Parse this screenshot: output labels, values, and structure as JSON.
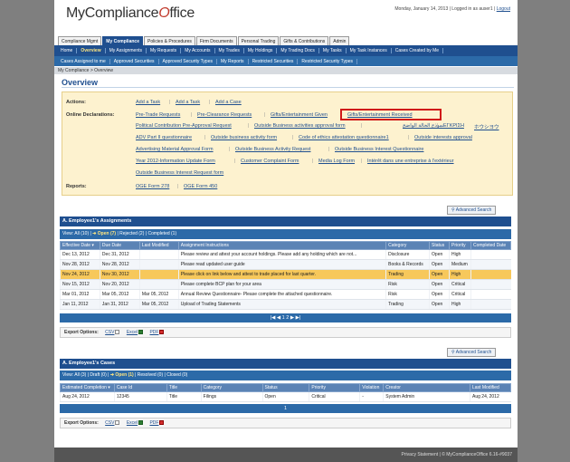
{
  "app": {
    "logo_left": "MyCompliance",
    "logo_mark": "O",
    "logo_right": "ffice",
    "date": "Monday, January 14, 2013 | Logged in as auser1 |",
    "logout": "Logout"
  },
  "tabs": [
    "Compliance Mgmt",
    "My Compliance",
    "Policies & Procedures",
    "Firm Documents",
    "Personal Trading",
    "Gifts & Contributions",
    "Admin"
  ],
  "nav1": [
    "Home",
    "Overview",
    "My Assignments",
    "My Requests",
    "My Accounts",
    "My Trades",
    "My Holdings",
    "My Trading Docs",
    "My Tasks",
    "My Task Instances",
    "Cases Created by Me"
  ],
  "nav2": [
    "Cases Assigned to me",
    "Approved Securities",
    "Approved Security Types",
    "My Reports",
    "Restricted Securities",
    "Restricted Security Types"
  ],
  "breadcrumb": "My Compliance > Overview",
  "page_title": "Overview",
  "actions": {
    "actions_label": "Actions:",
    "declarations_label": "Online Declarations:",
    "reports_label": "Reports:",
    "action_links": [
      "Add a Task",
      "Add a Task",
      "Add a Case"
    ],
    "decl_row1": [
      "Pre-Trade Requests",
      "Pre-Clearance Requests",
      "Gifts/Entertainment Given",
      "Gifts/Entertainment Received",
      "نموذج الحالة الواضح",
      "ΕΓΚΡΙΣΗ"
    ],
    "decl_row2": [
      "Political Contribution Pre-Approval Request",
      "Outside Business activities approval form",
      "ホウシヨウ"
    ],
    "decl_row3": [
      "ADV Part II questionnaire",
      "Outside business activity form",
      "Code of ethics attestation questionnaire1",
      "Outside interests approval"
    ],
    "decl_row4": [
      "Advertising Material Approval Form",
      "Outside Business Activity Request",
      "Outside Business Interest Questionnaire"
    ],
    "decl_row5": [
      "Year 2012-Information Update Form",
      "Customer Complaint Form",
      "Media Log Form",
      "Intérêt dans une entreprise à l'extérieur"
    ],
    "decl_row6": [
      "Outside Business Interest Request form"
    ],
    "report_links": [
      "OGE Form 278",
      "OGE Form 450"
    ]
  },
  "advanced_search_label": "Advanced Search",
  "assignments": {
    "title": "A. Employee1's Assignments",
    "view_label": "View:",
    "filters": [
      "All (10)",
      "Open (7)",
      "Rejected (2)",
      "Completed (1)"
    ],
    "columns": [
      "Effective Date",
      "Due Date",
      "Last Modified",
      "Assignment Instructions",
      "Category",
      "Status",
      "Priority",
      "Completed Date"
    ],
    "rows": [
      [
        "Dec 13, 2012",
        "Dec 31, 2012",
        "",
        "Please review and attest your account holdings. Please add any holding which are not...",
        "Disclosure",
        "Open",
        "High",
        ""
      ],
      [
        "Nov 28, 2012",
        "Nov 28, 2012",
        "",
        "Please read updated user guide",
        "Books & Records",
        "Open",
        "Medium",
        ""
      ],
      [
        "Nov 24, 2012",
        "Nov 30, 2012",
        "",
        "Please click on link below and attest to trade placed for last quarter.",
        "Trading",
        "Open",
        "High",
        ""
      ],
      [
        "Nov 15, 2012",
        "Nov 20, 2012",
        "",
        "Please complete BCP plan for your area",
        "Risk",
        "Open",
        "Critical",
        ""
      ],
      [
        "Mar 01, 2012",
        "Mar 05, 2012",
        "Mar 05, 2012",
        "Annual Review Questionnaire- Please complete the attached questionnaire.",
        "Risk",
        "Open",
        "Critical",
        ""
      ],
      [
        "Jan 11, 2012",
        "Jan 31, 2012",
        "Mar 05, 2012",
        "Upload of Trading Statements",
        "Trading",
        "Open",
        "High",
        ""
      ]
    ],
    "pager": "|◀ ◀ 1 2 ▶ ▶|"
  },
  "export": {
    "label": "Export Options:",
    "csv": "CSV",
    "excel": "Excel",
    "pdf": "PDF"
  },
  "cases": {
    "title": "A. Employee1's Cases",
    "view_label": "View:",
    "filters": [
      "All (3)",
      "Draft (0)",
      "Open (1)",
      "Resolved (0)",
      "Closed (0)"
    ],
    "columns": [
      "Estimated Completion",
      "Case Id",
      "Title",
      "Category",
      "Status",
      "Priority",
      "Violation",
      "Creator",
      "Last Modified"
    ],
    "rows": [
      [
        "Aug 24, 2012",
        "12345",
        "Title",
        "Filings",
        "Open",
        "Critical",
        "-",
        "System Admin",
        "Aug 24, 2012"
      ]
    ],
    "pager": "1"
  },
  "footer": "Privacy Statement | © MyComplianceOffice 6.16-#9037"
}
